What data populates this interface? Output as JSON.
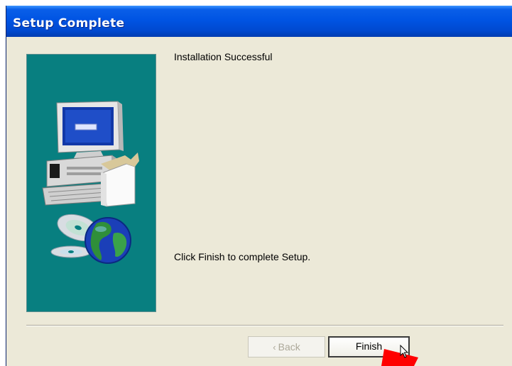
{
  "window": {
    "title": "Setup Complete"
  },
  "content": {
    "heading": "Installation Successful",
    "instruction": "Click Finish to complete Setup."
  },
  "buttons": {
    "back_label": "Back",
    "back_icon": "chevron-left-icon",
    "finish_label": "Finish"
  },
  "colors": {
    "titlebar": "#0054e3",
    "panel": "#087f80",
    "dialog_bg": "#ece9d8",
    "annotation_arrow": "#ff0000"
  }
}
